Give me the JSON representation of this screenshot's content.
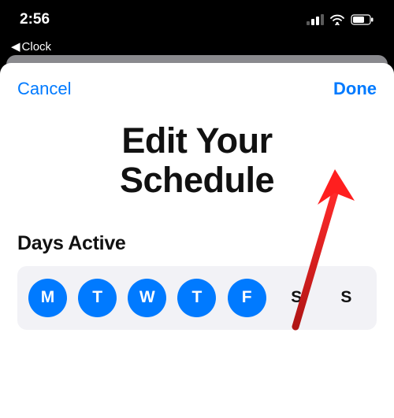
{
  "status": {
    "time": "2:56",
    "back_app_label": "Clock"
  },
  "nav": {
    "cancel": "Cancel",
    "done": "Done"
  },
  "title_line1": "Edit Your",
  "title_line2": "Schedule",
  "section": {
    "days_active_label": "Days Active"
  },
  "days": [
    {
      "label": "M",
      "active": true
    },
    {
      "label": "T",
      "active": true
    },
    {
      "label": "W",
      "active": true
    },
    {
      "label": "T",
      "active": true
    },
    {
      "label": "F",
      "active": true
    },
    {
      "label": "S",
      "active": false
    },
    {
      "label": "S",
      "active": false
    }
  ],
  "colors": {
    "accent": "#007aff"
  }
}
